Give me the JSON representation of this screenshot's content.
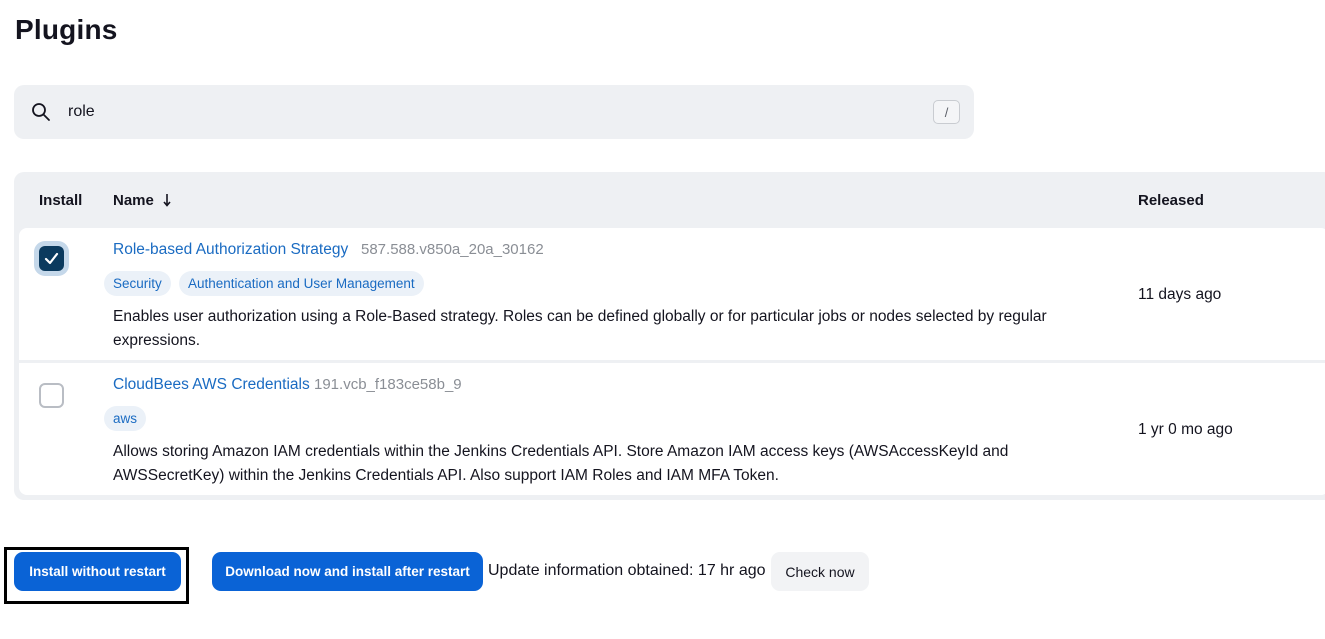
{
  "page": {
    "title": "Plugins"
  },
  "search": {
    "value": "role",
    "shortcut": "/"
  },
  "table": {
    "headers": {
      "install": "Install",
      "name": "Name",
      "sort_indicator": "↓",
      "released": "Released"
    },
    "rows": [
      {
        "checked": true,
        "name": "Role-based Authorization Strategy",
        "version": "587.588.v850a_20a_30162",
        "tags": [
          "Security",
          "Authentication and User Management"
        ],
        "excerpt": "Enables user authorization using a Role-Based strategy. Roles can be defined globally or for particular jobs or nodes selected by regular expressions.",
        "released": "11 days ago"
      },
      {
        "checked": false,
        "name": "CloudBees AWS Credentials",
        "version": "191.vcb_f183ce58b_9",
        "tags": [
          "aws"
        ],
        "excerpt": "Allows storing Amazon IAM credentials within the Jenkins Credentials API. Store Amazon IAM access keys (AWSAccessKeyId and AWSSecretKey) within the Jenkins Credentials API. Also support IAM Roles and IAM MFA Token.",
        "released": "1 yr 0 mo ago"
      }
    ]
  },
  "footer": {
    "install_button": "Install without restart",
    "download_button": "Download now and install after restart",
    "update_info": "Update information obtained: 17 hr ago",
    "check_button": "Check now"
  },
  "colors": {
    "accent": "#0a63d6",
    "link": "#1a6bc2",
    "checkbox_checked": "#0b3a5e",
    "surface": "#eef0f3"
  },
  "icons": {
    "search": "search-icon",
    "sort": "arrow-down-icon",
    "check": "check-icon"
  }
}
